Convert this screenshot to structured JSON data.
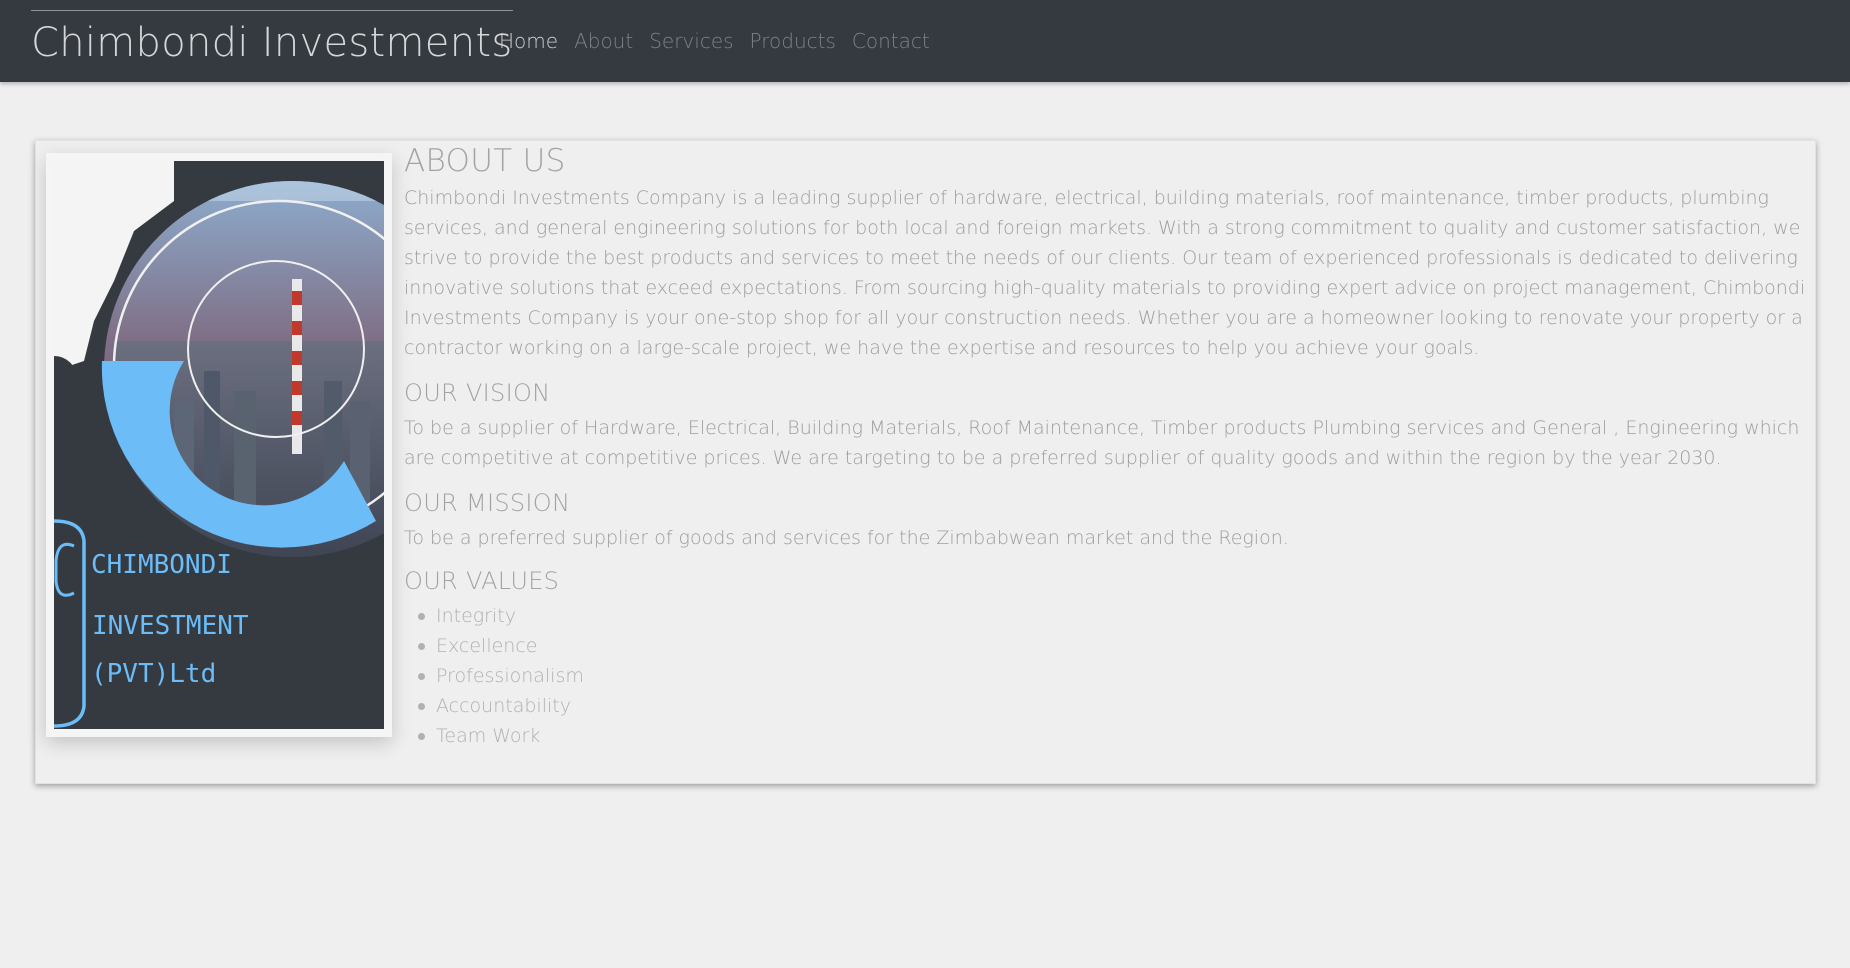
{
  "header": {
    "brand": "Chimbondi Investments",
    "nav": [
      "Home",
      "About",
      "Services",
      "Products",
      "Contact"
    ],
    "active_nav": "Home"
  },
  "logo": {
    "line1": "CHIMBONDI",
    "line2": "INVESTMENT",
    "line3": "(PVT)Ltd",
    "accent_color": "#6bbcf7",
    "dark_color": "#343a40"
  },
  "about": {
    "title": "ABOUT US",
    "body": "Chimbondi Investments Company is a leading supplier of hardware, electrical, building materials, roof maintenance, timber products, plumbing services, and general engineering solutions for both local and foreign markets. With a strong commitment to quality and customer satisfaction, we strive to provide the best products and services to meet the needs of our clients. Our team of experienced professionals is dedicated to delivering innovative solutions that exceed expectations. From sourcing high-quality materials to providing expert advice on project management, Chimbondi Investments Company is your one-stop shop for all your construction needs. Whether you are a homeowner looking to renovate your property or a contractor working on a large-scale project, we have the expertise and resources to help you achieve your goals."
  },
  "vision": {
    "title": "OUR VISION",
    "body": "To be a supplier of Hardware, Electrical, Building Materials, Roof Maintenance, Timber products Plumbing services and General , Engineering which are competitive at competitive prices. We are targeting to be a preferred supplier of quality goods and within the region by the year 2030."
  },
  "mission": {
    "title": "OUR MISSION",
    "body": "To be a preferred supplier of goods and services for the Zimbabwean market and the Region."
  },
  "values": {
    "title": "OUR VALUES",
    "items": [
      "Integrity",
      "Excellence",
      "Professionalism",
      "Accountability",
      "Team Work"
    ]
  }
}
